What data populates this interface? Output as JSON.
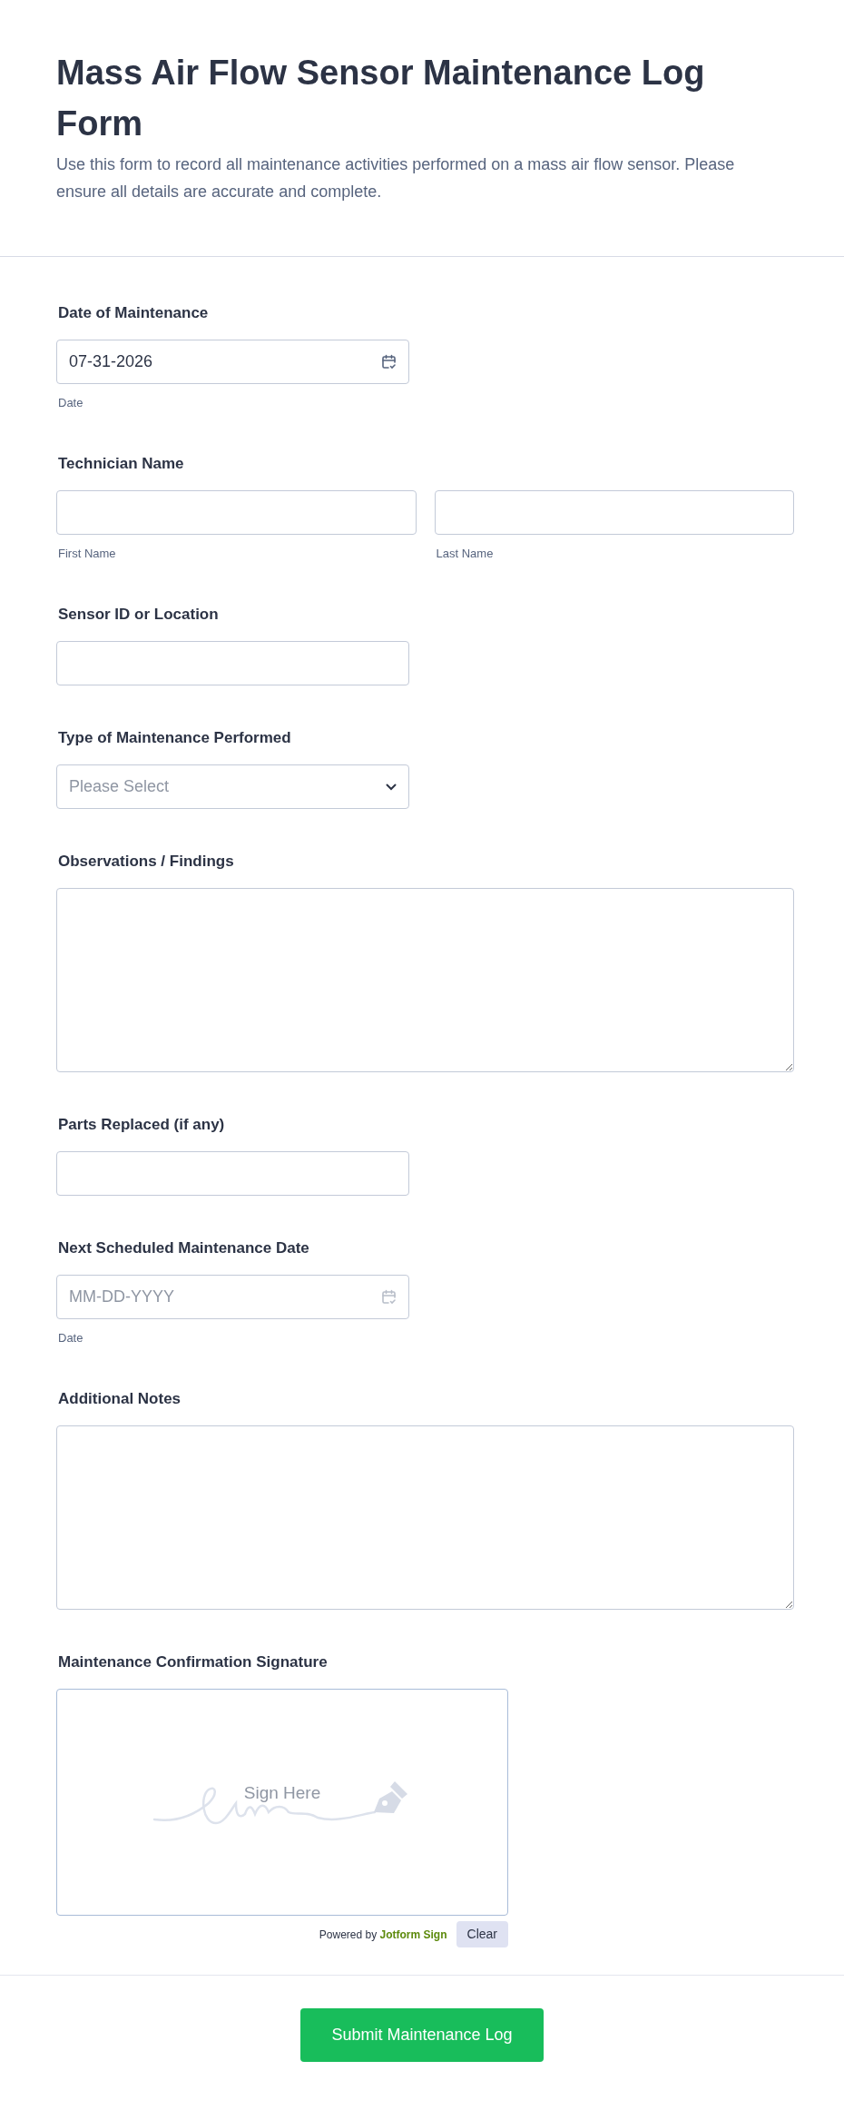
{
  "header": {
    "title": "Mass Air Flow Sensor Maintenance Log Form",
    "description": "Use this form to record all maintenance activities performed on a mass air flow sensor. Please ensure all details are accurate and complete."
  },
  "fields": [
    {
      "kind": "date",
      "label": "Date of Maintenance",
      "value": "07-31-2026",
      "sublabel": "Date"
    },
    {
      "kind": "name",
      "label": "Technician Name",
      "parts": [
        {
          "sublabel": "First Name"
        },
        {
          "sublabel": "Last Name"
        }
      ]
    },
    {
      "kind": "text",
      "label": "Sensor ID or Location"
    },
    {
      "kind": "select",
      "label": "Type of Maintenance Performed",
      "placeholder": "Please Select"
    },
    {
      "kind": "textarea",
      "label": "Observations / Findings"
    },
    {
      "kind": "text",
      "label": "Parts Replaced (if any)"
    },
    {
      "kind": "date",
      "label": "Next Scheduled Maintenance Date",
      "placeholder": "MM-DD-YYYY",
      "sublabel": "Date"
    },
    {
      "kind": "textarea",
      "label": "Additional Notes"
    },
    {
      "kind": "signature",
      "label": "Maintenance Confirmation Signature",
      "prompt": "Sign Here",
      "powered_by": "Powered by",
      "brand": "Jotform Sign",
      "clear_button": "Clear"
    }
  ],
  "submit_button": "Submit Maintenance Log"
}
